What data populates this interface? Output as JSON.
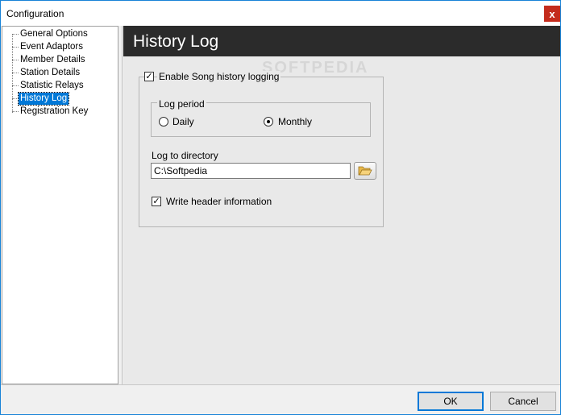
{
  "window": {
    "title": "Configuration",
    "close_glyph": "x"
  },
  "tree": {
    "items": [
      {
        "label": "General Options",
        "selected": false
      },
      {
        "label": "Event Adaptors",
        "selected": false
      },
      {
        "label": "Member Details",
        "selected": false
      },
      {
        "label": "Station Details",
        "selected": false
      },
      {
        "label": "Statistic Relays",
        "selected": false
      },
      {
        "label": "History Log",
        "selected": true
      },
      {
        "label": "Registration Key",
        "selected": false
      }
    ]
  },
  "panel": {
    "title": "History Log",
    "watermark": "SOFTPEDIA",
    "enable_logging": {
      "label": "Enable Song history logging",
      "checked": true
    },
    "log_period": {
      "legend": "Log period",
      "options": [
        {
          "label": "Daily",
          "checked": false
        },
        {
          "label": "Monthly",
          "checked": true
        }
      ]
    },
    "log_directory": {
      "label": "Log to directory",
      "value": "C:\\Softpedia",
      "browse_icon": "folder-open-icon"
    },
    "write_header": {
      "label": "Write header information",
      "checked": true
    }
  },
  "footer": {
    "ok_label": "OK",
    "cancel_label": "Cancel"
  },
  "colors": {
    "selection": "#0078d7",
    "header_bg": "#2b2b2b",
    "close_bg": "#c42b1c",
    "folder": "#e8b84a"
  }
}
